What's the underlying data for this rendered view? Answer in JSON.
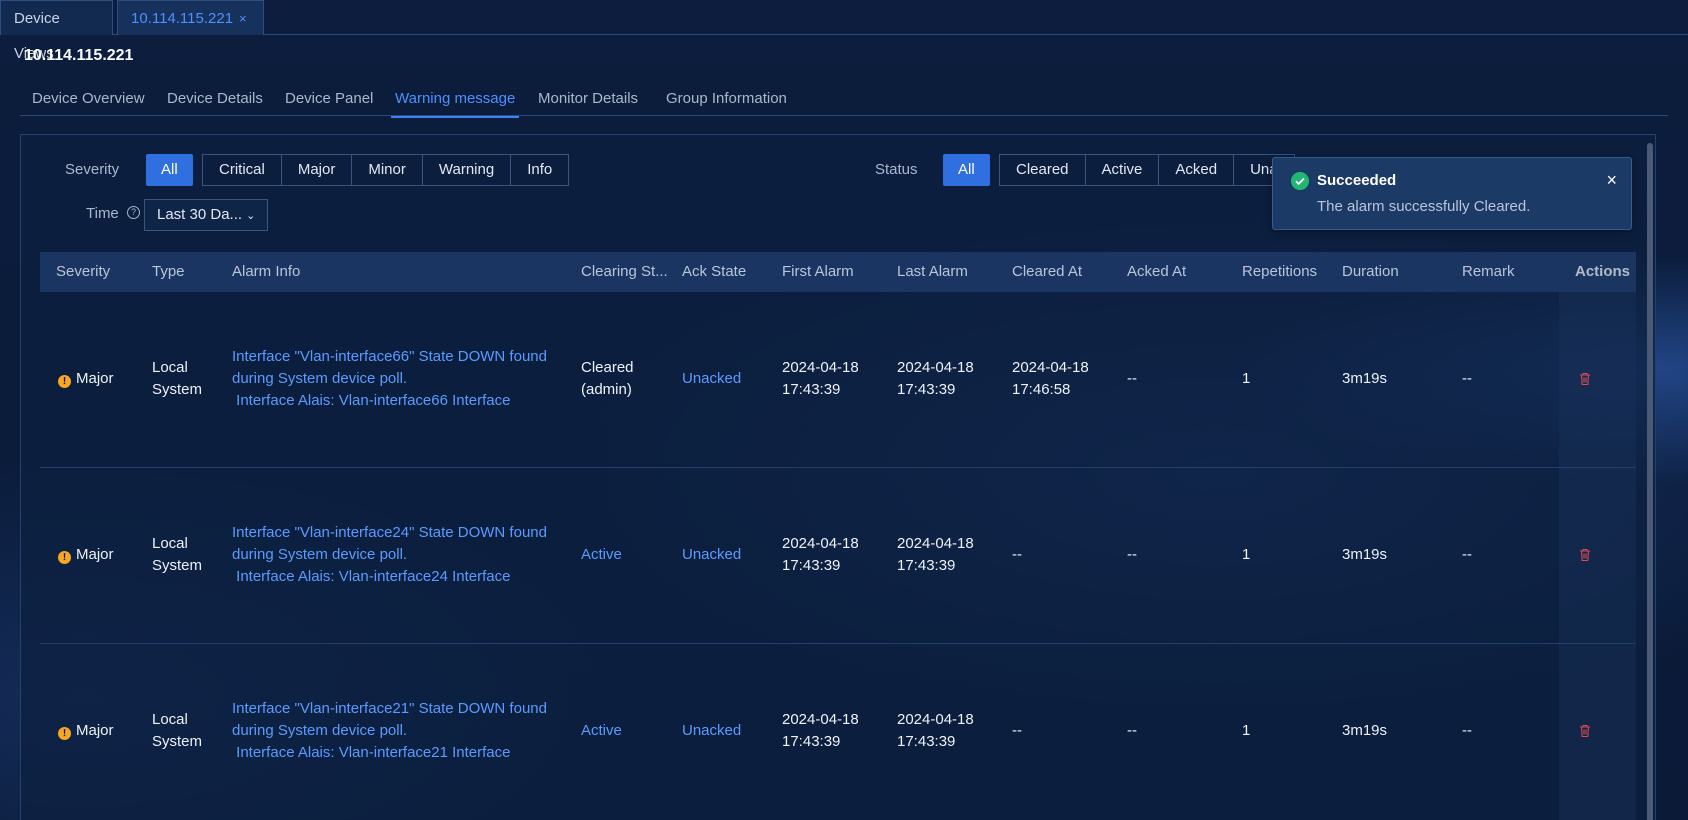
{
  "window_tabs": [
    {
      "label": "Device Views"
    },
    {
      "label": "10.114.115.221",
      "close": "×"
    }
  ],
  "device_title": "10.114.115.221",
  "sub_tabs": [
    "Device Overview",
    "Device Details",
    "Device Panel",
    "Warning message",
    "Monitor Details",
    "Group Information"
  ],
  "active_sub_tab": "Warning message",
  "filters": {
    "severity_label": "Severity",
    "severity_all": "All",
    "severity_options": [
      "Critical",
      "Major",
      "Minor",
      "Warning",
      "Info"
    ],
    "status_label": "Status",
    "status_all": "All",
    "status_options": [
      "Cleared",
      "Active",
      "Acked",
      "Una"
    ],
    "time_label": "Time",
    "time_help_icon": "question-circle-icon",
    "time_value": "Last 30 Da...",
    "time_chevron": "⌄"
  },
  "table": {
    "columns": [
      "Severity",
      "Type",
      "Alarm Info",
      "Clearing St...",
      "Ack State",
      "First Alarm",
      "Last Alarm",
      "Cleared At",
      "Acked At",
      "Repetitions",
      "Duration",
      "Remark",
      "Actions"
    ],
    "rows": [
      {
        "severity": "Major",
        "type_line1": "Local",
        "type_line2": "System",
        "info_line1": "Interface \"Vlan-interface66\" State DOWN found",
        "info_line2": "during System device poll.",
        "info_line3": " Interface Alais: Vlan-interface66 Interface",
        "clearing_line1": "Cleared",
        "clearing_line2": "(admin)",
        "ack_state": "Unacked",
        "first_date": "2024-04-18",
        "first_time": "17:43:39",
        "last_date": "2024-04-18",
        "last_time": "17:43:39",
        "cleared_date": "2024-04-18",
        "cleared_time": "17:46:58",
        "acked_at": "--",
        "repetitions": "1",
        "duration": "3m19s",
        "remark": "--"
      },
      {
        "severity": "Major",
        "type_line1": "Local",
        "type_line2": "System",
        "info_line1": "Interface \"Vlan-interface24\" State DOWN found",
        "info_line2": "during System device poll.",
        "info_line3": " Interface Alais: Vlan-interface24 Interface",
        "clearing_line1": "Active",
        "clearing_line2": "",
        "ack_state": "Unacked",
        "first_date": "2024-04-18",
        "first_time": "17:43:39",
        "last_date": "2024-04-18",
        "last_time": "17:43:39",
        "cleared_date": "--",
        "cleared_time": "",
        "acked_at": "--",
        "repetitions": "1",
        "duration": "3m19s",
        "remark": "--"
      },
      {
        "severity": "Major",
        "type_line1": "Local",
        "type_line2": "System",
        "info_line1": "Interface \"Vlan-interface21\" State DOWN found",
        "info_line2": "during System device poll.",
        "info_line3": " Interface Alais: Vlan-interface21 Interface",
        "clearing_line1": "Active",
        "clearing_line2": "",
        "ack_state": "Unacked",
        "first_date": "2024-04-18",
        "first_time": "17:43:39",
        "last_date": "2024-04-18",
        "last_time": "17:43:39",
        "cleared_date": "--",
        "cleared_time": "",
        "acked_at": "--",
        "repetitions": "1",
        "duration": "3m19s",
        "remark": "--"
      }
    ]
  },
  "toast": {
    "title": "Succeeded",
    "message": "The alarm successfully Cleared.",
    "close": "×",
    "icon": "check-circle-icon"
  },
  "colors": {
    "accent": "#3b82f6",
    "link": "#5b9bff",
    "severity_major": "#f5a623",
    "delete_icon": "#e0484e",
    "success": "#22b573"
  }
}
